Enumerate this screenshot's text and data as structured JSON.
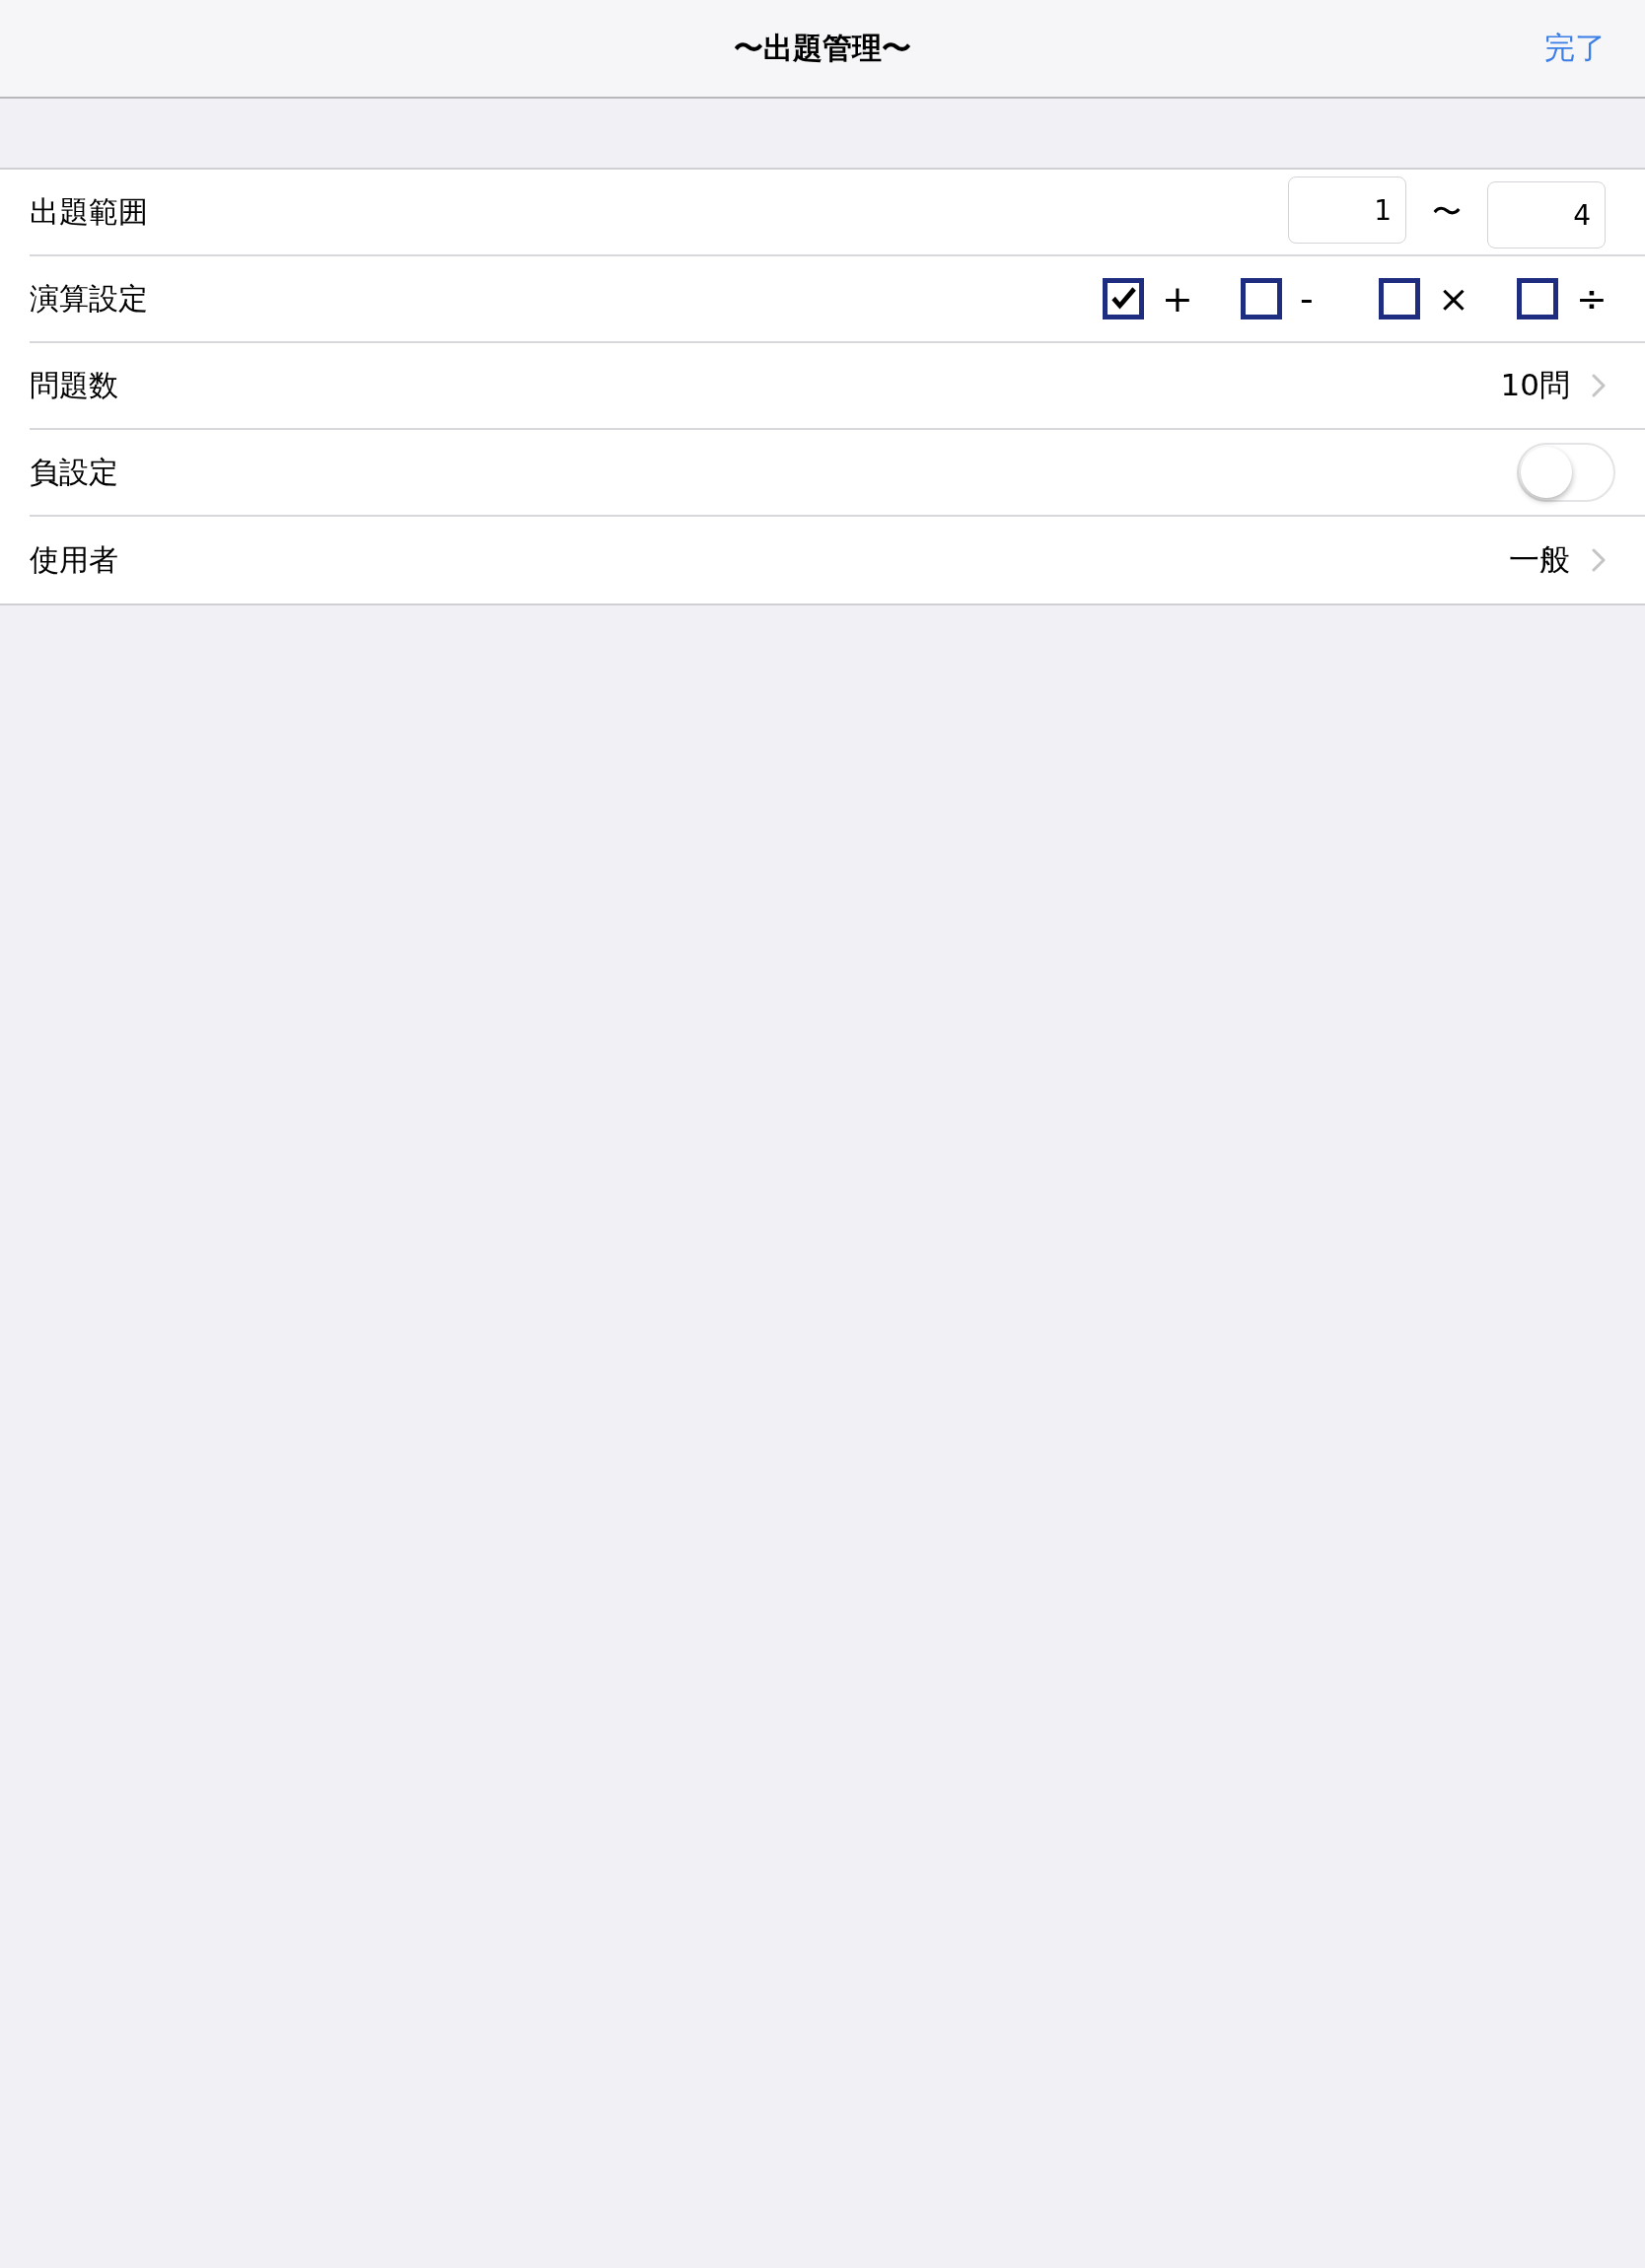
{
  "nav": {
    "title": "〜出題管理〜",
    "done": "完了"
  },
  "rows": [
    {
      "kind": "range",
      "label": "出題範囲",
      "from": "1",
      "separator": "〜",
      "to": "4"
    },
    {
      "kind": "operations",
      "label": "演算設定",
      "options": [
        {
          "symbol": "+",
          "checked": true
        },
        {
          "symbol": "-",
          "checked": false
        },
        {
          "symbol": "×",
          "checked": false
        },
        {
          "symbol": "÷",
          "checked": false
        }
      ]
    },
    {
      "kind": "disclosure",
      "label": "問題数",
      "value": "10問"
    },
    {
      "kind": "toggle",
      "label": "負設定",
      "on": false
    },
    {
      "kind": "disclosure",
      "label": "使用者",
      "value": "一般"
    }
  ]
}
